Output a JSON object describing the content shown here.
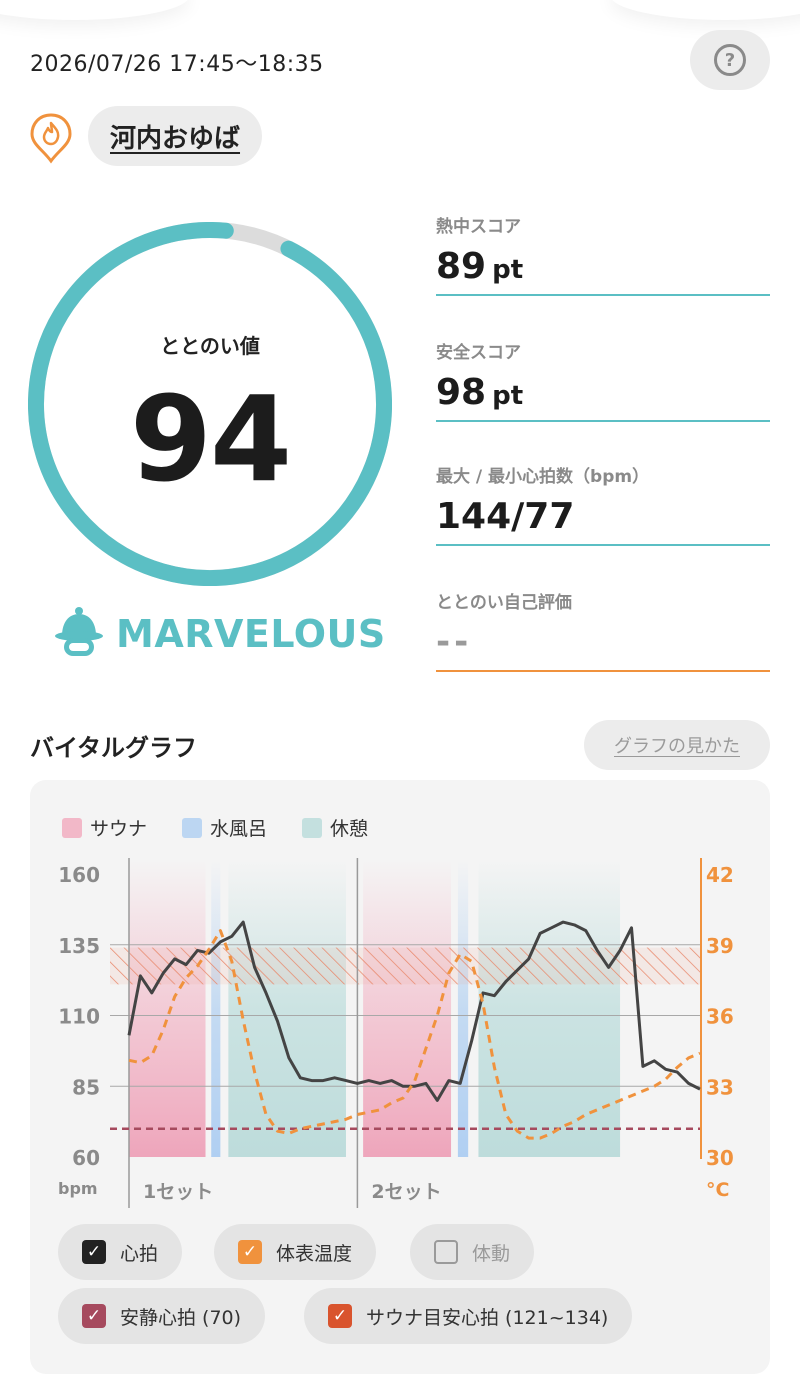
{
  "header": {
    "datetime": "2026/07/26 17:45〜18:35",
    "help_glyph": "?",
    "facility_name": "河内おゆば",
    "facility_icon": "flame-pin-icon"
  },
  "score": {
    "label": "ととのい値",
    "value": "94",
    "progress": 0.94,
    "rank_icon": "sauna-hat-icon",
    "rank": "MARVELOUS",
    "ring_color": "#5bbfc4"
  },
  "metrics": [
    {
      "label": "熱中スコア",
      "value": "89",
      "unit": "pt"
    },
    {
      "label": "安全スコア",
      "value": "98",
      "unit": "pt"
    },
    {
      "label": "最大 / 最小心拍数（bpm）",
      "value": "144/77",
      "unit": ""
    },
    {
      "label": "ととのい自己評価",
      "value": "--",
      "unit": ""
    }
  ],
  "vital": {
    "title": "バイタルグラフ",
    "howto": "グラフの見かた",
    "legend": [
      {
        "label": "サウナ",
        "color": "#f2b8c8"
      },
      {
        "label": "水風呂",
        "color": "#bcd6f2"
      },
      {
        "label": "休憩",
        "color": "#c4e0df"
      }
    ],
    "chips": [
      {
        "label": "心拍",
        "checked": true,
        "color": "#222222"
      },
      {
        "label": "体表温度",
        "checked": true,
        "color": "#f0923d"
      },
      {
        "label": "体動",
        "checked": false,
        "color": "#9a9a9a"
      },
      {
        "label": "安静心拍 (70)",
        "checked": true,
        "color": "#a64a5e"
      },
      {
        "label": "サウナ目安心拍 (121~134)",
        "checked": true,
        "color": "#d9542e"
      }
    ]
  },
  "chart_data": {
    "type": "line",
    "x": [
      0,
      1,
      2,
      3,
      4,
      5,
      6,
      7,
      8,
      9,
      10,
      11,
      12,
      13,
      14,
      15,
      16,
      17,
      18,
      19,
      20,
      21,
      22,
      23,
      24,
      25,
      26,
      27,
      28,
      29,
      30,
      31,
      32,
      33,
      34,
      35,
      36,
      37,
      38,
      39,
      40,
      41,
      42,
      43,
      44,
      45,
      46,
      47,
      48,
      49,
      50
    ],
    "xlabels": [
      "1セット",
      "2セット"
    ],
    "ylabel_left": "bpm",
    "ylabel_right": "°C",
    "ylim_left": [
      60,
      160
    ],
    "ylim_right": [
      30,
      42
    ],
    "yticks_left": [
      160,
      135,
      110,
      85,
      60
    ],
    "yticks_right": [
      42,
      39,
      36,
      33,
      30
    ],
    "zones": [
      {
        "type": "sauna",
        "start": 0.0,
        "end": 6.7
      },
      {
        "type": "water",
        "start": 7.2,
        "end": 8.0
      },
      {
        "type": "rest",
        "start": 8.7,
        "end": 19.0
      },
      {
        "type": "sauna",
        "start": 20.5,
        "end": 28.2
      },
      {
        "type": "water",
        "start": 28.8,
        "end": 29.7
      },
      {
        "type": "rest",
        "start": 30.6,
        "end": 43.0
      }
    ],
    "set_starts": [
      0,
      20
    ],
    "resting_hr": 70,
    "target_hr": [
      121,
      134
    ],
    "series": [
      {
        "name": "心拍",
        "color": "#444444",
        "axis": "left",
        "values": [
          103,
          124,
          118,
          125,
          130,
          128,
          133,
          132,
          136,
          138,
          143,
          127,
          118,
          108,
          95,
          88,
          87,
          87,
          88,
          87,
          86,
          87,
          86,
          87,
          85,
          85,
          86,
          80,
          87,
          86,
          101,
          118,
          117,
          122,
          126,
          130,
          139,
          141,
          143,
          142,
          140,
          133,
          127,
          133,
          141,
          92,
          94,
          91,
          90,
          86,
          84
        ]
      },
      {
        "name": "体表温度",
        "color": "#f0923d",
        "axis": "right",
        "values": [
          34.1,
          34.0,
          34.3,
          35.4,
          36.8,
          37.6,
          38.1,
          38.8,
          39.6,
          38.3,
          35.8,
          33.6,
          31.8,
          31.1,
          31.0,
          31.2,
          31.3,
          31.4,
          31.5,
          31.6,
          31.8,
          31.9,
          32.0,
          32.3,
          32.5,
          33.2,
          34.6,
          36.0,
          37.8,
          38.6,
          38.3,
          36.5,
          33.8,
          31.8,
          31.1,
          30.8,
          30.8,
          31.0,
          31.3,
          31.5,
          31.8,
          32.0,
          32.2,
          32.4,
          32.6,
          32.8,
          33.0,
          33.3,
          33.8,
          34.2,
          34.4
        ]
      }
    ],
    "grid": true
  }
}
